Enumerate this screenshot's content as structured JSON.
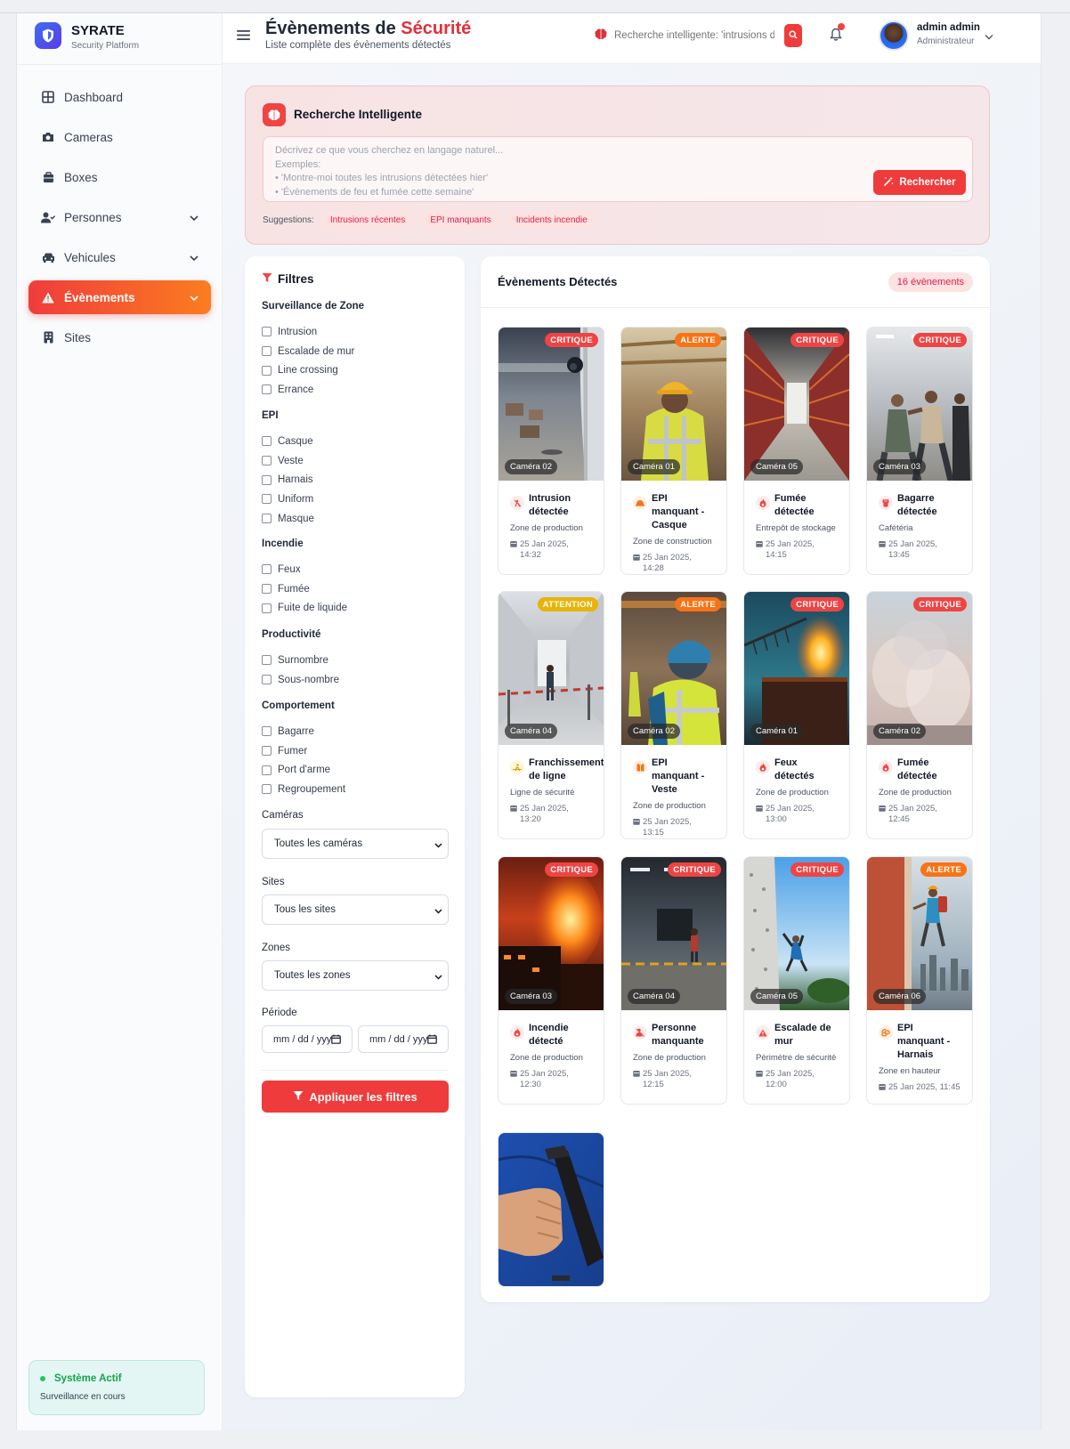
{
  "brand": {
    "name": "SYRATE",
    "subtitle": "Security Platform"
  },
  "nav": {
    "items": [
      {
        "label": "Dashboard",
        "icon": "dashboard-icon"
      },
      {
        "label": "Cameras",
        "icon": "camera-icon"
      },
      {
        "label": "Boxes",
        "icon": "box-icon"
      },
      {
        "label": "Personnes",
        "icon": "user-icon",
        "expandable": true
      },
      {
        "label": "Vehicules",
        "icon": "car-icon",
        "expandable": true
      },
      {
        "label": "Évènements",
        "icon": "warning-icon",
        "expandable": true,
        "active": true
      },
      {
        "label": "Sites",
        "icon": "building-icon"
      }
    ]
  },
  "system_status": {
    "title": "Système Actif",
    "subtitle": "Surveillance en cours"
  },
  "header": {
    "title_prefix": "Évènements de",
    "title_accent": "Sécurité",
    "subtitle": "Liste complète des évènements détectés",
    "search_placeholder": "Recherche intelligente: 'intrusions d'hier'",
    "user_name": "admin admin",
    "user_role": "Administrateur"
  },
  "smart_search": {
    "title": "Recherche Intelligente",
    "placeholder_lines": [
      "Décrivez ce que vous cherchez en langage naturel...",
      "Exemples:",
      "• 'Montre-moi toutes les intrusions détectées hier'",
      "• 'Évènements de feu et fumée cette semaine'"
    ],
    "button_label": "Rechercher",
    "suggestions_label": "Suggestions:",
    "suggestions": [
      "Intrusions récentes",
      "EPI manquants",
      "Incidents incendie"
    ]
  },
  "filters": {
    "title": "Filtres",
    "groups": [
      {
        "label": "Surveillance de Zone",
        "options": [
          "Intrusion",
          "Escalade de mur",
          "Line crossing",
          "Errance"
        ]
      },
      {
        "label": "EPI",
        "options": [
          "Casque",
          "Veste",
          "Harnais",
          "Uniform",
          "Masque"
        ]
      },
      {
        "label": "Incendie",
        "options": [
          "Feux",
          "Fumée",
          "Fuite de liquide"
        ]
      },
      {
        "label": "Productivité",
        "options": [
          "Surnombre",
          "Sous-nombre"
        ]
      },
      {
        "label": "Comportement",
        "options": [
          "Bagarre",
          "Fumer",
          "Port d'arme",
          "Regroupement"
        ]
      }
    ],
    "cameras_label": "Caméras",
    "cameras_value": "Toutes les caméras",
    "sites_label": "Sites",
    "sites_value": "Tous les sites",
    "zones_label": "Zones",
    "zones_value": "Toutes les zones",
    "period_label": "Période",
    "date_placeholder": "mm / dd / yyyy",
    "apply_label": "Appliquer les filtres"
  },
  "events": {
    "title": "Évènements Détectés",
    "count_label": "16 évènements",
    "items": [
      {
        "severity": "CRITIQUE",
        "camera": "Caméra 02",
        "title": "Intrusion détectée",
        "zone": "Zone de production",
        "date": "25 Jan 2025, 14:32",
        "icon": "intrusion-icon"
      },
      {
        "severity": "ALERTE",
        "camera": "Caméra 01",
        "title": "EPI manquant - Casque",
        "zone": "Zone de construction",
        "date": "25 Jan 2025, 14:28",
        "icon": "helmet-icon"
      },
      {
        "severity": "CRITIQUE",
        "camera": "Caméra 05",
        "title": "Fumée détectée",
        "zone": "Entrepôt de stockage",
        "date": "25 Jan 2025, 14:15",
        "icon": "fire-icon"
      },
      {
        "severity": "CRITIQUE",
        "camera": "Caméra 03",
        "title": "Bagarre détectée",
        "zone": "Cafétéria",
        "date": "25 Jan 2025, 13:45",
        "icon": "fist-icon"
      },
      {
        "severity": "ATTENTION",
        "camera": "Caméra 04",
        "title": "Franchissement de ligne",
        "zone": "Ligne de sécurité",
        "date": "25 Jan 2025, 13:20",
        "icon": "line-crossing-icon"
      },
      {
        "severity": "ALERTE",
        "camera": "Caméra 02",
        "title": "EPI manquant - Veste",
        "zone": "Zone de production",
        "date": "25 Jan 2025, 13:15",
        "icon": "vest-icon"
      },
      {
        "severity": "CRITIQUE",
        "camera": "Caméra 01",
        "title": "Feux détectés",
        "zone": "Zone de production",
        "date": "25 Jan 2025, 13:00",
        "icon": "fire-icon"
      },
      {
        "severity": "CRITIQUE",
        "camera": "Caméra 02",
        "title": "Fumée détectée",
        "zone": "Zone de production",
        "date": "25 Jan 2025, 12:45",
        "icon": "fire-icon"
      },
      {
        "severity": "CRITIQUE",
        "camera": "Caméra 03",
        "title": "Incendie détecté",
        "zone": "Zone de production",
        "date": "25 Jan 2025, 12:30",
        "icon": "fire-icon"
      },
      {
        "severity": "CRITIQUE",
        "camera": "Caméra 04",
        "title": "Personne manquante",
        "zone": "Zone de production",
        "date": "25 Jan 2025, 12:15",
        "icon": "person-missing-icon"
      },
      {
        "severity": "CRITIQUE",
        "camera": "Caméra 05",
        "title": "Escalade de mur",
        "zone": "Périmètre de sécurité",
        "date": "25 Jan 2025, 12:00",
        "icon": "warning-icon"
      },
      {
        "severity": "ALERTE",
        "camera": "Caméra 06",
        "title": "EPI manquant - Harnais",
        "zone": "Zone en hauteur",
        "date": "25 Jan 2025, 11:45",
        "icon": "harness-icon"
      },
      {
        "severity": "",
        "camera": "",
        "title": "",
        "zone": "",
        "date": "",
        "icon": "gun-image"
      }
    ]
  },
  "colors": {
    "accent": "#ef3b3b",
    "accent_orange": "#f97316",
    "attention": "#eab308",
    "success": "#22c55e"
  }
}
